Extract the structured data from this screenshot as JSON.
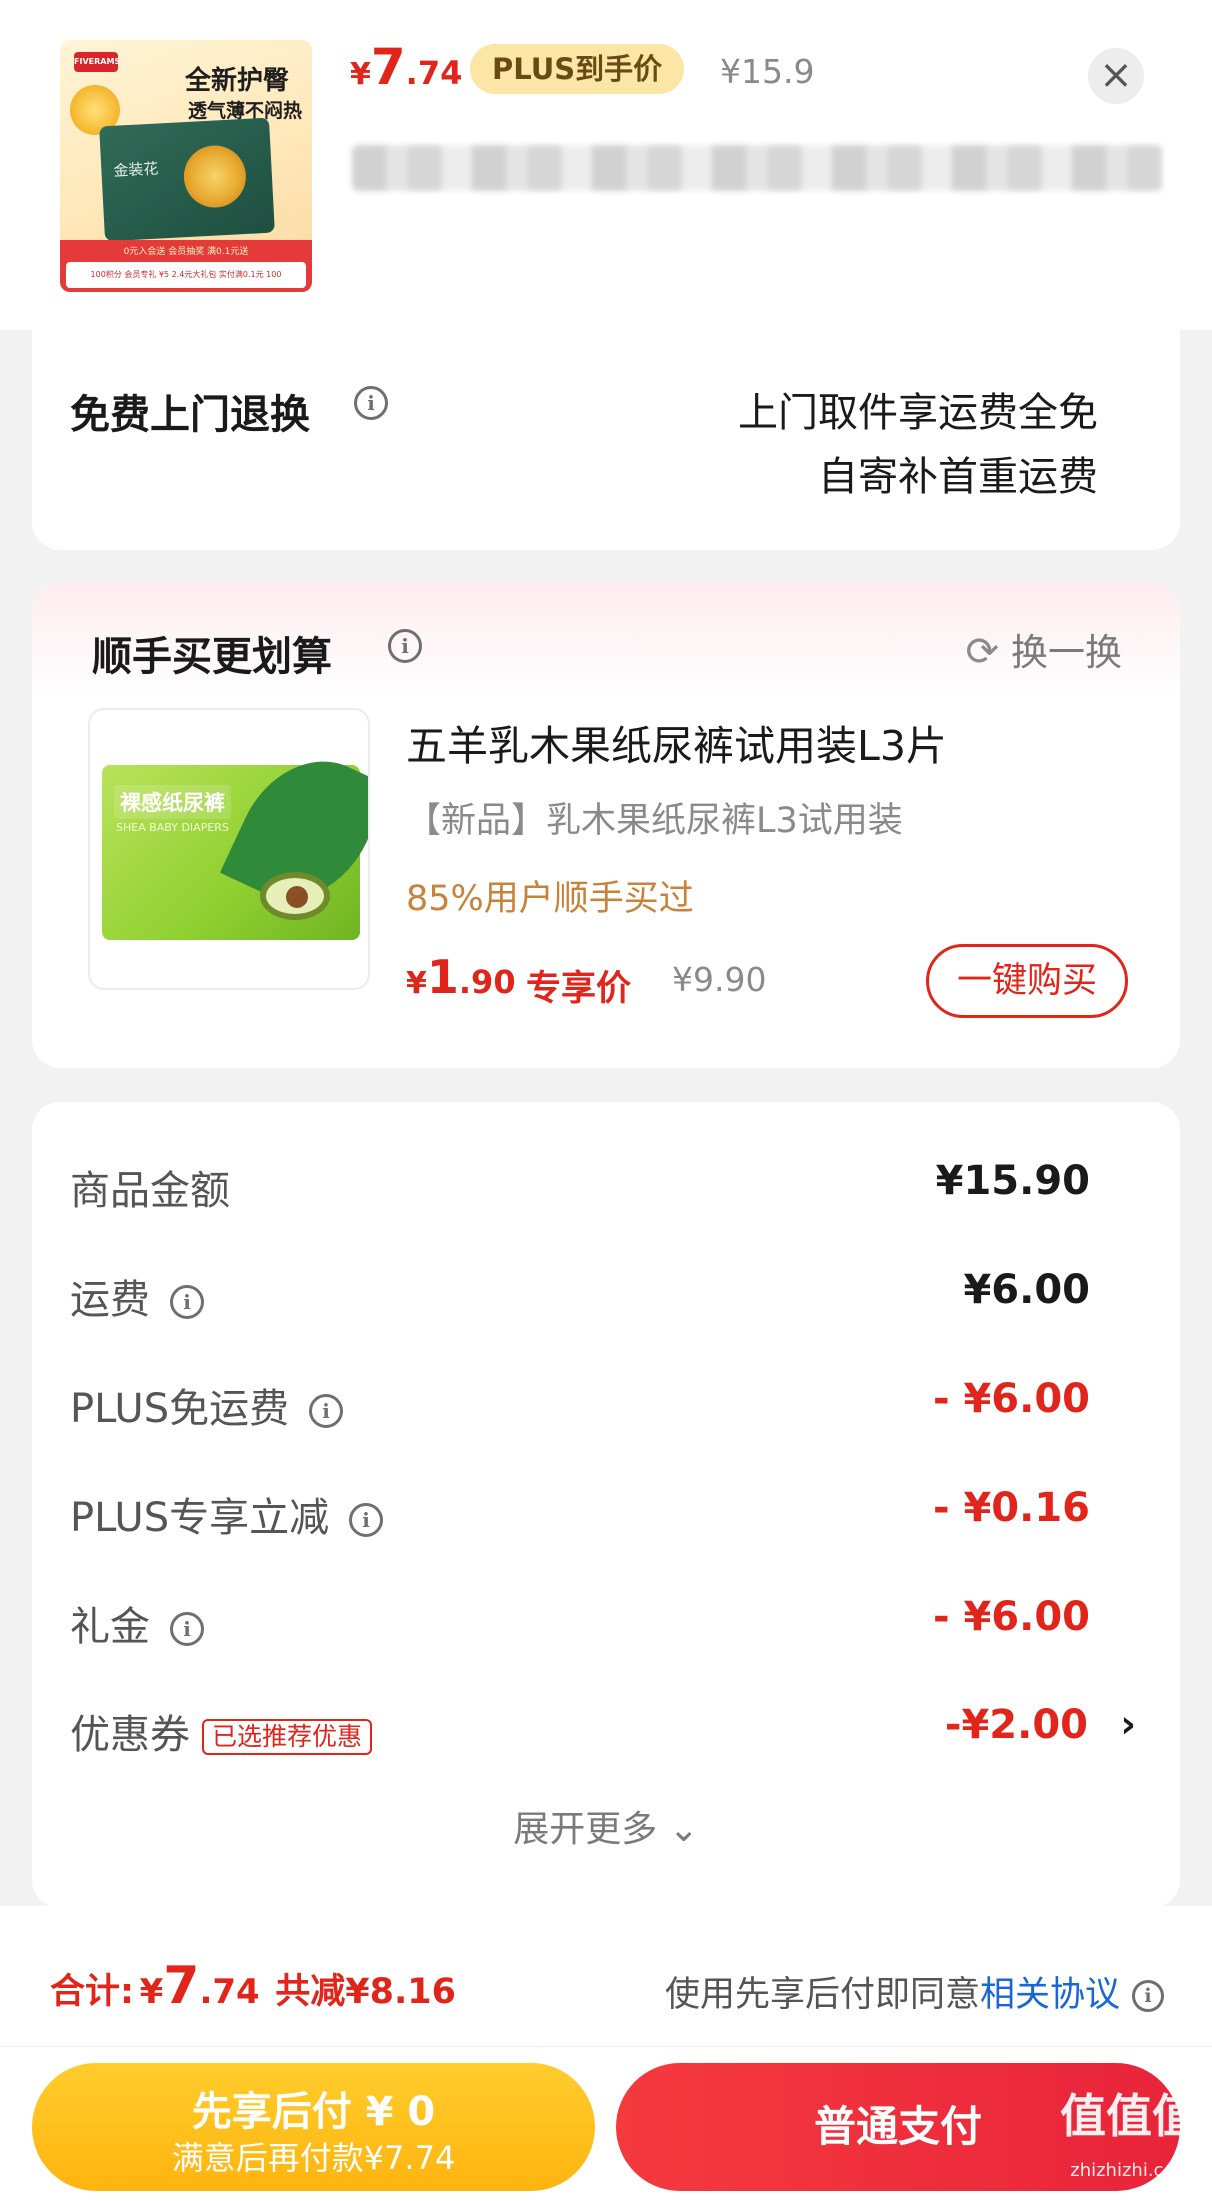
{
  "header": {
    "thumb": {
      "brand": "五羊 FIVERAMS",
      "ad_title": "全新护臀",
      "ad_subtitle": "透气薄不闷热",
      "pack_name": "金装花",
      "banner_top": "0元入会送    会员抽奖    满0.1元送",
      "banner_row": "100积分  会员专礼  ¥5  2.4元大礼包  实付满0.1元  100"
    },
    "price": {
      "yen": "¥",
      "int": "7",
      "dec": ".74"
    },
    "plus_tag": "PLUS到手价",
    "original_price": "¥15.9",
    "close": "×"
  },
  "return_service": {
    "title": "免费上门退换",
    "line1": "上门取件享运费全免",
    "line2": "自寄补首重运费"
  },
  "upsell": {
    "title": "顺手买更划算",
    "swap_label": "换一换",
    "image_label": "裸感纸尿裤",
    "image_sub": "SHEA BABY DIAPERS",
    "product_name": "五羊乳木果纸尿裤试用装L3片",
    "subtitle": "【新品】乳木果纸尿裤L3试用装",
    "social_proof": "85%用户顺手买过",
    "price": {
      "yen": "¥",
      "int": "1",
      "dec": ".90"
    },
    "exclusive_label": "专享价",
    "original_price": "¥9.90",
    "buy_button": "一键购买"
  },
  "summary": {
    "rows": [
      {
        "label": "商品金额",
        "value": "¥15.90"
      },
      {
        "label": "运费",
        "value": "¥6.00"
      },
      {
        "label": "PLUS免运费",
        "value": "- ¥6.00"
      },
      {
        "label": "PLUS专享立减",
        "value": "- ¥0.16"
      },
      {
        "label": "礼金",
        "value": "- ¥6.00"
      },
      {
        "label": "优惠券",
        "tag": "已选推荐优惠",
        "value": "-¥2.00"
      }
    ],
    "expand": "展开更多 ⌄"
  },
  "total": {
    "label": "合计:",
    "yen": "¥",
    "int": "7",
    "dec": ".74",
    "saved": "共减¥8.16",
    "agree_text": "使用先享后付即同意",
    "agree_link": "相关协议"
  },
  "pay": {
    "later_title": "先享后付 ¥ 0",
    "later_sub": "满意后再付款¥7.74",
    "normal": "普通支付"
  },
  "watermark": {
    "main": "值值值",
    "sub": "zhizhizhi.com"
  },
  "colors": {
    "accent_red": "#e1251b",
    "plus_gold": "#fbe6a6",
    "pay_later_yellow": "#ffb40f",
    "link_blue": "#1a66d6"
  }
}
